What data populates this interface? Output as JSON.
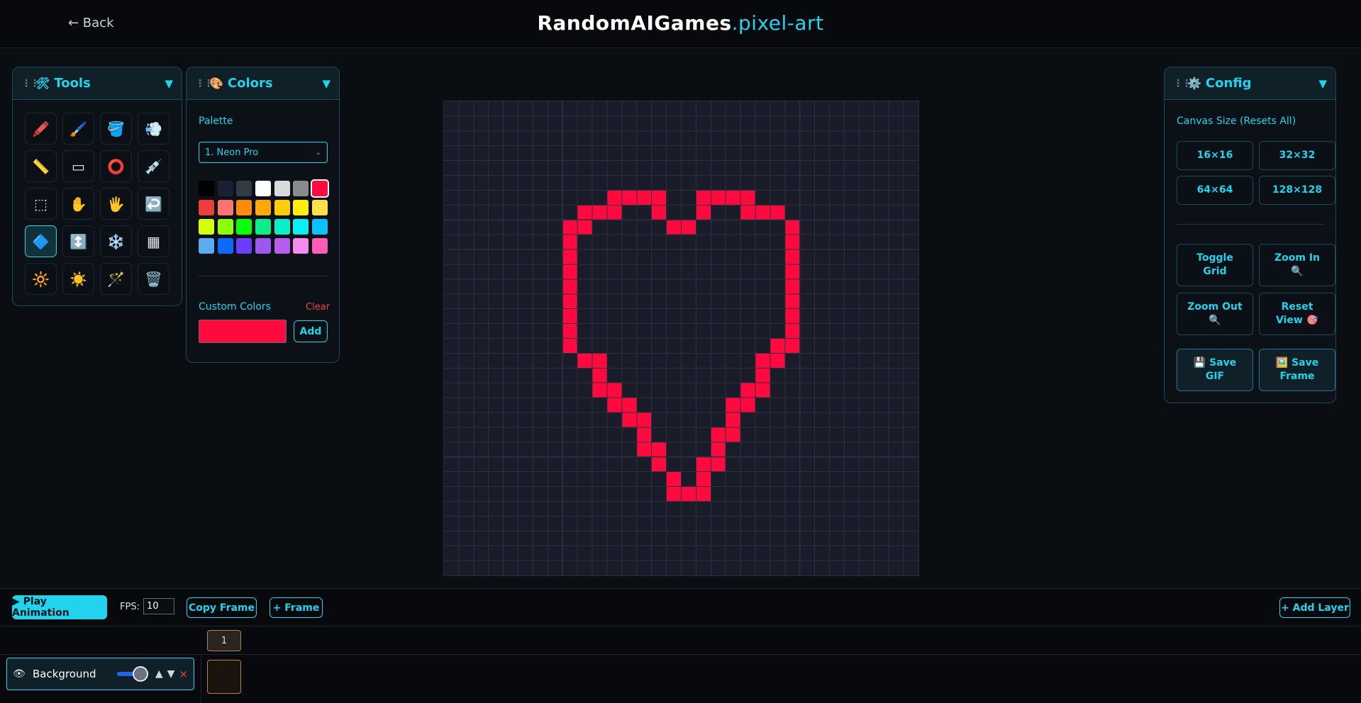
{
  "header": {
    "back_label": "← Back",
    "brand_main": "RandomAIGames",
    "brand_suffix": ".pixel-art"
  },
  "tools_panel": {
    "title": "Tools",
    "icon": "hammer-wrench-icon",
    "tools": [
      {
        "name": "pencil",
        "glyph": "🖍️"
      },
      {
        "name": "brush",
        "glyph": "🖌️"
      },
      {
        "name": "fill-bucket",
        "glyph": "🪣"
      },
      {
        "name": "spray",
        "glyph": "💨"
      },
      {
        "name": "line",
        "glyph": "📏"
      },
      {
        "name": "rectangle",
        "glyph": "▭"
      },
      {
        "name": "circle",
        "glyph": "⭕"
      },
      {
        "name": "eyedropper",
        "glyph": "💉"
      },
      {
        "name": "select",
        "glyph": "⬚"
      },
      {
        "name": "hand-move",
        "glyph": "✋"
      },
      {
        "name": "pan",
        "glyph": "🖐️"
      },
      {
        "name": "undo",
        "glyph": "↩️"
      },
      {
        "name": "mirror",
        "glyph": "🔷"
      },
      {
        "name": "flip-vertical",
        "glyph": "↕️"
      },
      {
        "name": "frost",
        "glyph": "❄️"
      },
      {
        "name": "checker",
        "glyph": "▦"
      },
      {
        "name": "brighten",
        "glyph": "🔆"
      },
      {
        "name": "darken",
        "glyph": "☀️"
      },
      {
        "name": "magic-wand",
        "glyph": "🪄"
      },
      {
        "name": "trash",
        "glyph": "🗑️"
      }
    ],
    "active_index": 12
  },
  "colors_panel": {
    "title": "Colors",
    "icon": "palette-icon",
    "palette_label": "Palette",
    "palette_selected": "1. Neon Pro",
    "swatches": [
      "#000000",
      "#1b1f33",
      "#323c47",
      "#ffffff",
      "#d9d9d9",
      "#8a8a8a",
      "#ff0a3f",
      "#ee3d3d",
      "#ff7373",
      "#ff8a0a",
      "#ffa80a",
      "#ffcc0a",
      "#ffee0a",
      "#ffe04a",
      "#d6ff0a",
      "#8dff0a",
      "#0aff0a",
      "#0aef8a",
      "#0aefc9",
      "#0aefef",
      "#0ac2ff",
      "#58acef",
      "#0a6cff",
      "#6a3dff",
      "#9b59ef",
      "#b65cef",
      "#f78aef",
      "#ff5cb8"
    ],
    "selected_swatch": 6,
    "custom_label": "Custom Colors",
    "clear_label": "Clear",
    "custom_color": "#ff0a3f",
    "add_label": "Add"
  },
  "config_panel": {
    "title": "Config",
    "icon": "gear-icon",
    "canvas_size_label": "Canvas Size (Resets All)",
    "sizes": [
      "16×16",
      "32×32",
      "64×64",
      "128×128"
    ],
    "toggle_grid": "Toggle Grid",
    "zoom_in": "Zoom In 🔍",
    "zoom_out": "Zoom Out 🔍",
    "reset_view": "Reset View 🎯",
    "save_gif": "💾 Save GIF",
    "save_frame": "🖼️ Save Frame"
  },
  "canvas": {
    "grid_size": 32,
    "background": "#1a1c2a",
    "grid_line": "#2d3040",
    "pixel_color": "#ff0a3f",
    "pixels": [
      [
        11,
        6
      ],
      [
        12,
        6
      ],
      [
        13,
        6
      ],
      [
        14,
        6
      ],
      [
        17,
        6
      ],
      [
        18,
        6
      ],
      [
        19,
        6
      ],
      [
        20,
        6
      ],
      [
        9,
        7
      ],
      [
        10,
        7
      ],
      [
        11,
        7
      ],
      [
        14,
        7
      ],
      [
        17,
        7
      ],
      [
        20,
        7
      ],
      [
        21,
        7
      ],
      [
        22,
        7
      ],
      [
        8,
        8
      ],
      [
        9,
        8
      ],
      [
        15,
        8
      ],
      [
        16,
        8
      ],
      [
        23,
        8
      ],
      [
        8,
        9
      ],
      [
        23,
        9
      ],
      [
        8,
        10
      ],
      [
        23,
        10
      ],
      [
        8,
        11
      ],
      [
        23,
        11
      ],
      [
        8,
        12
      ],
      [
        23,
        12
      ],
      [
        8,
        13
      ],
      [
        23,
        13
      ],
      [
        8,
        14
      ],
      [
        23,
        14
      ],
      [
        8,
        15
      ],
      [
        23,
        15
      ],
      [
        8,
        16
      ],
      [
        22,
        16
      ],
      [
        23,
        16
      ],
      [
        9,
        17
      ],
      [
        10,
        17
      ],
      [
        21,
        17
      ],
      [
        22,
        17
      ],
      [
        10,
        18
      ],
      [
        21,
        18
      ],
      [
        10,
        19
      ],
      [
        11,
        19
      ],
      [
        20,
        19
      ],
      [
        21,
        19
      ],
      [
        11,
        20
      ],
      [
        12,
        20
      ],
      [
        19,
        20
      ],
      [
        20,
        20
      ],
      [
        12,
        21
      ],
      [
        13,
        21
      ],
      [
        19,
        21
      ],
      [
        13,
        22
      ],
      [
        18,
        22
      ],
      [
        19,
        22
      ],
      [
        13,
        23
      ],
      [
        14,
        23
      ],
      [
        18,
        23
      ],
      [
        14,
        24
      ],
      [
        17,
        24
      ],
      [
        18,
        24
      ],
      [
        15,
        25
      ],
      [
        17,
        25
      ],
      [
        15,
        26
      ],
      [
        16,
        26
      ],
      [
        17,
        26
      ]
    ]
  },
  "animation_bar": {
    "play_label": "▶ Play Animation",
    "fps_label": "FPS:",
    "fps_value": "10",
    "copy_frame_label": "Copy Frame",
    "add_frame_label": "+ Frame",
    "add_layer_label": "+ Add Layer",
    "frame_numbers": [
      "1"
    ],
    "layers": [
      {
        "name": "Background",
        "visible_icon": "eye-icon",
        "opacity": 1.0
      }
    ],
    "delete_glyph": "×",
    "up_glyph": "▲",
    "down_glyph": "▼"
  }
}
